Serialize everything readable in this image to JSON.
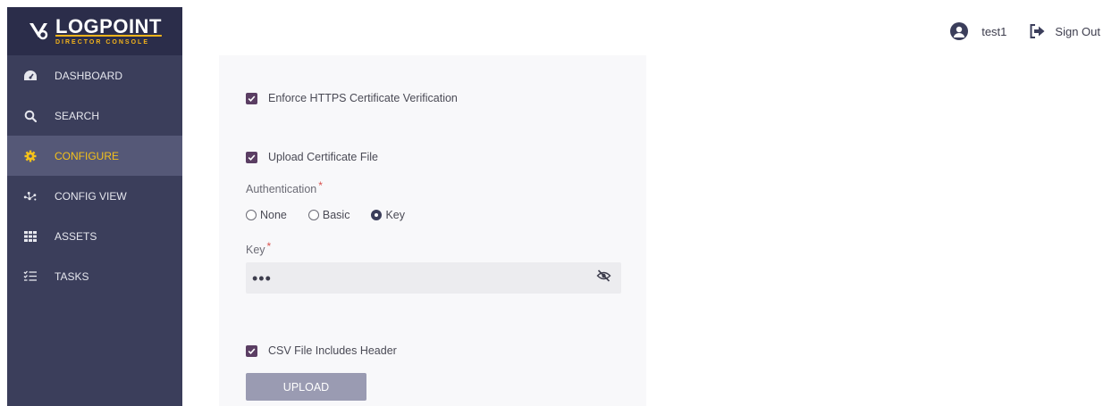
{
  "brand": {
    "name": "LOGPOINT",
    "subtitle": "DIRECTOR CONSOLE"
  },
  "nav": {
    "dashboard": "DASHBOARD",
    "search": "SEARCH",
    "configure": "CONFIGURE",
    "config_view": "CONFIG VIEW",
    "assets": "ASSETS",
    "tasks": "TASKS"
  },
  "header": {
    "username": "test1",
    "sign_out": "Sign Out"
  },
  "form": {
    "enforce_https": {
      "label": "Enforce HTTPS Certificate Verification",
      "checked": true
    },
    "upload_cert": {
      "label": "Upload Certificate File",
      "checked": true
    },
    "authentication": {
      "label": "Authentication",
      "required_mark": "*",
      "options": [
        "None",
        "Basic",
        "Key"
      ],
      "selected": "Key"
    },
    "key": {
      "label": "Key",
      "required_mark": "*",
      "value": "•••"
    },
    "csv_header": {
      "label": "CSV File Includes Header",
      "checked": true
    },
    "upload_button": "UPLOAD"
  },
  "colors": {
    "sidebar_bg": "#3b3e5b",
    "logo_bg": "#2b2d4a",
    "active_item_bg": "#555877",
    "accent_yellow": "#f5c21a",
    "checkbox": "#5b3e63",
    "upload_button": "#9a9bb2",
    "required": "#d9534f"
  }
}
